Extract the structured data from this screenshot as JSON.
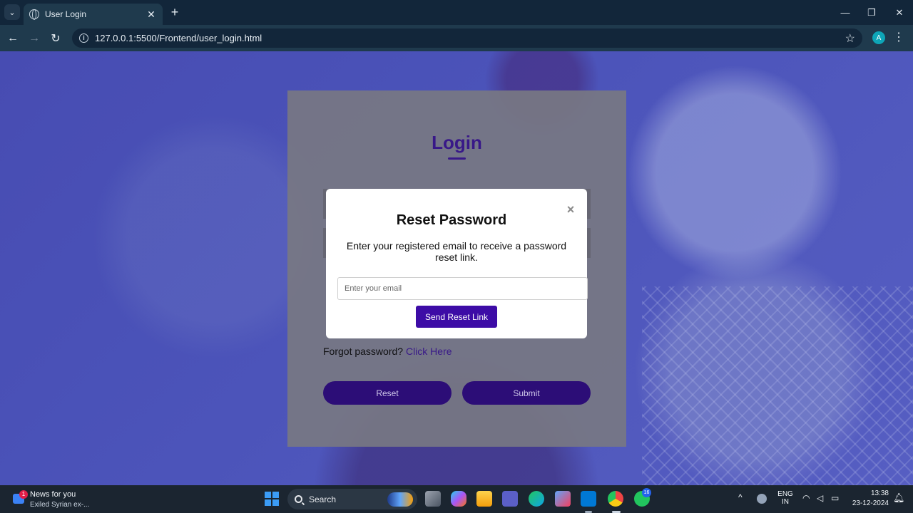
{
  "browser": {
    "tab_title": "User Login",
    "url": "127.0.0.1:5500/Frontend/user_login.html",
    "profile_initial": "A"
  },
  "login": {
    "title": "Login",
    "forgot_prefix": "Forgot password?",
    "forgot_link": "Click Here",
    "reset_button": "Reset",
    "submit_button": "Submit"
  },
  "modal": {
    "title": "Reset Password",
    "close_glyph": "×",
    "description": "Enter your registered email to receive a password reset link.",
    "email_placeholder": "Enter your email",
    "email_value": "",
    "send_button": "Send Reset Link"
  },
  "taskbar": {
    "news_title": "News for you",
    "news_subtitle": "Exiled Syrian ex-...",
    "news_badge": "1",
    "search_label": "Search",
    "whatsapp_badge": "16",
    "lang_line1": "ENG",
    "lang_line2": "IN",
    "time": "13:38",
    "date": "23-12-2024"
  },
  "colors": {
    "accent": "#3d0ca6",
    "login_title": "#3b1a8c",
    "page_background": "#5058c0"
  }
}
